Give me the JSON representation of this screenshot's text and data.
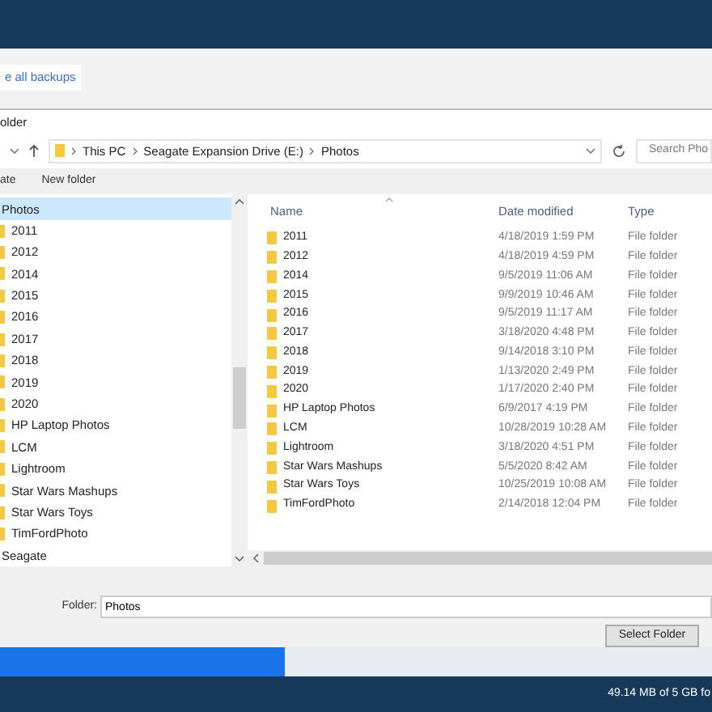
{
  "app": {
    "backups_button": "e all backups",
    "status": "49.14 MB of 5 GB fo"
  },
  "dialog": {
    "title": "older",
    "address": {
      "path": [
        "This PC",
        "Seagate Expansion Drive (E:)",
        "Photos"
      ],
      "search_placeholder": "Search Pho"
    },
    "toolbar": [
      "ate",
      "New folder"
    ],
    "tree": [
      {
        "label": "Photos",
        "selected": true,
        "children": [
          {
            "label": "2011",
            "selected": false
          },
          {
            "label": "2012",
            "selected": false
          },
          {
            "label": "2014",
            "selected": false
          },
          {
            "label": "2015",
            "selected": false
          },
          {
            "label": "2016",
            "selected": false
          },
          {
            "label": "2017",
            "selected": false
          },
          {
            "label": "2018",
            "selected": false
          },
          {
            "label": "2019",
            "selected": false
          },
          {
            "label": "2020",
            "selected": false
          },
          {
            "label": "HP Laptop Photos",
            "selected": false
          },
          {
            "label": "LCM",
            "selected": false
          },
          {
            "label": "Lightroom",
            "selected": false
          },
          {
            "label": "Star Wars Mashups",
            "selected": false
          },
          {
            "label": "Star Wars Toys",
            "selected": false
          },
          {
            "label": "TimFordPhoto",
            "selected": false
          }
        ]
      },
      {
        "label": "Seagate",
        "selected": false
      }
    ],
    "columns": [
      "Name",
      "Date modified",
      "Type"
    ],
    "rows": [
      [
        "2011",
        "4/18/2019 1:59 PM",
        "File folder"
      ],
      [
        "2012",
        "4/18/2019 4:59 PM",
        "File folder"
      ],
      [
        "2014",
        "9/5/2019 11:06 AM",
        "File folder"
      ],
      [
        "2015",
        "9/9/2019 10:46 AM",
        "File folder"
      ],
      [
        "2016",
        "9/5/2019 11:17 AM",
        "File folder"
      ],
      [
        "2017",
        "3/18/2020 4:48 PM",
        "File folder"
      ],
      [
        "2018",
        "9/14/2018 3:10 PM",
        "File folder"
      ],
      [
        "2019",
        "1/13/2020 2:49 PM",
        "File folder"
      ],
      [
        "2020",
        "1/17/2020 2:40 PM",
        "File folder"
      ],
      [
        "HP Laptop Photos",
        "6/9/2017 4:19 PM",
        "File folder"
      ],
      [
        "LCM",
        "10/28/2019 10:28 AM",
        "File folder"
      ],
      [
        "Lightroom",
        "3/18/2020 4:51 PM",
        "File folder"
      ],
      [
        "Star Wars Mashups",
        "5/5/2020 8:42 AM",
        "File folder"
      ],
      [
        "Star Wars Toys",
        "10/25/2019 10:08 AM",
        "File folder"
      ],
      [
        "TimFordPhoto",
        "2/14/2018 12:04 PM",
        "File folder"
      ]
    ],
    "folder_field": {
      "label": "Folder:",
      "value": "Photos"
    },
    "select_button": "Select Folder"
  }
}
